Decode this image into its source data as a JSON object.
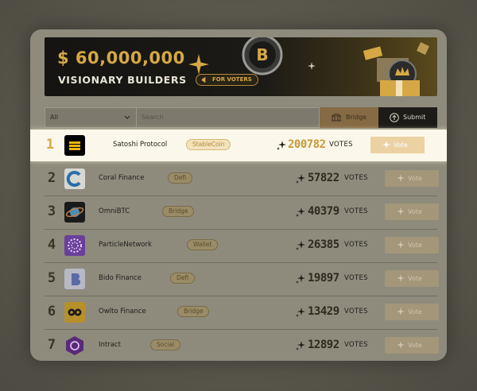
{
  "banner": {
    "amount": "$ 60,000,000",
    "subtitle": "VISIONARY BUILDERS",
    "badge": "FOR VOTERS"
  },
  "filter": {
    "select_value": "All",
    "search_placeholder": "Search",
    "bridge_label": "Bridge",
    "submit_label": "Submit"
  },
  "projects": [
    {
      "rank": "1",
      "name": "Satoshi Protocol",
      "tag": "StableCoin",
      "score": "200782",
      "votes_label": "VOTES",
      "vote_label": "Vote",
      "logo": "satoshi-logo"
    },
    {
      "rank": "2",
      "name": "Coral Finance",
      "tag": "Defi",
      "score": "57822",
      "votes_label": "VOTES",
      "vote_label": "Vote",
      "logo": "coral-logo"
    },
    {
      "rank": "3",
      "name": "OmniBTC",
      "tag": "Bridge",
      "score": "40379",
      "votes_label": "VOTES",
      "vote_label": "Vote",
      "logo": "omnibtc-logo"
    },
    {
      "rank": "4",
      "name": "ParticleNetwork",
      "tag": "Wallet",
      "score": "26385",
      "votes_label": "VOTES",
      "vote_label": "Vote",
      "logo": "particle-logo"
    },
    {
      "rank": "5",
      "name": "Bido Finance",
      "tag": "Defi",
      "score": "19897",
      "votes_label": "VOTES",
      "vote_label": "Vote",
      "logo": "bido-logo"
    },
    {
      "rank": "6",
      "name": "Owlto Finance",
      "tag": "Bridge",
      "score": "13429",
      "votes_label": "VOTES",
      "vote_label": "Vote",
      "logo": "owlto-logo"
    },
    {
      "rank": "7",
      "name": "Intract",
      "tag": "Social",
      "score": "12892",
      "votes_label": "VOTES",
      "vote_label": "Vote",
      "logo": "intract-logo"
    }
  ],
  "colors": {
    "accent_gold": "#d6a845",
    "highlight_bg": "#fbf7ea",
    "submit_bg": "#1c1b18"
  }
}
